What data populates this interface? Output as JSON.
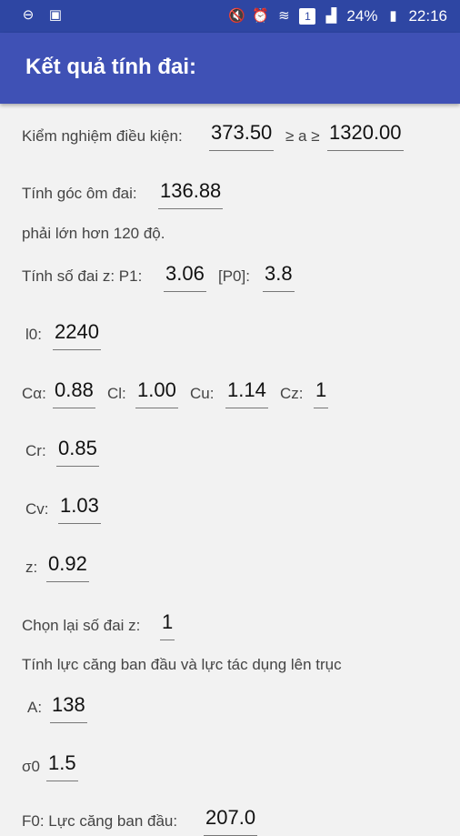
{
  "status_bar": {
    "battery": "24%",
    "time": "22:16",
    "sim": "1"
  },
  "app_bar": {
    "title": "Kết quả tính đai:"
  },
  "kiem_nghiem": {
    "label": "Kiểm nghiệm điều kiện:",
    "min": "373.50",
    "mid": "≥ a ≥",
    "max": "1320.00"
  },
  "goc_om": {
    "label": "Tính góc ôm đai:",
    "value": "136.88",
    "note": "phải lớn hơn 120 độ."
  },
  "so_dai": {
    "label_p1": "Tính số đai z: P1:",
    "p1": "3.06",
    "label_p0": "[P0]:",
    "p0": "3.8"
  },
  "l0": {
    "label": "l0:",
    "value": "2240"
  },
  "coeffs": {
    "ca_label": "Cα:",
    "ca": "0.88",
    "cl_label": "Cl:",
    "cl": "1.00",
    "cu_label": "Cu:",
    "cu": "1.14",
    "cz_label": "Cz:",
    "cz": "1"
  },
  "cr": {
    "label": "Cr:",
    "value": "0.85"
  },
  "cv": {
    "label": "Cv:",
    "value": "1.03"
  },
  "z": {
    "label": "z:",
    "value": "0.92"
  },
  "chon_lai": {
    "label": "Chọn lại số đai z:",
    "value": "1"
  },
  "luc_cang": {
    "heading": "Tính lực căng ban đầu và lực tác dụng lên trục"
  },
  "A": {
    "label": "A:",
    "value": "138"
  },
  "sigma": {
    "label": "σ0",
    "value": "1.5"
  },
  "f0": {
    "label": "F0: Lực căng ban đầu:",
    "value": "207.0"
  }
}
